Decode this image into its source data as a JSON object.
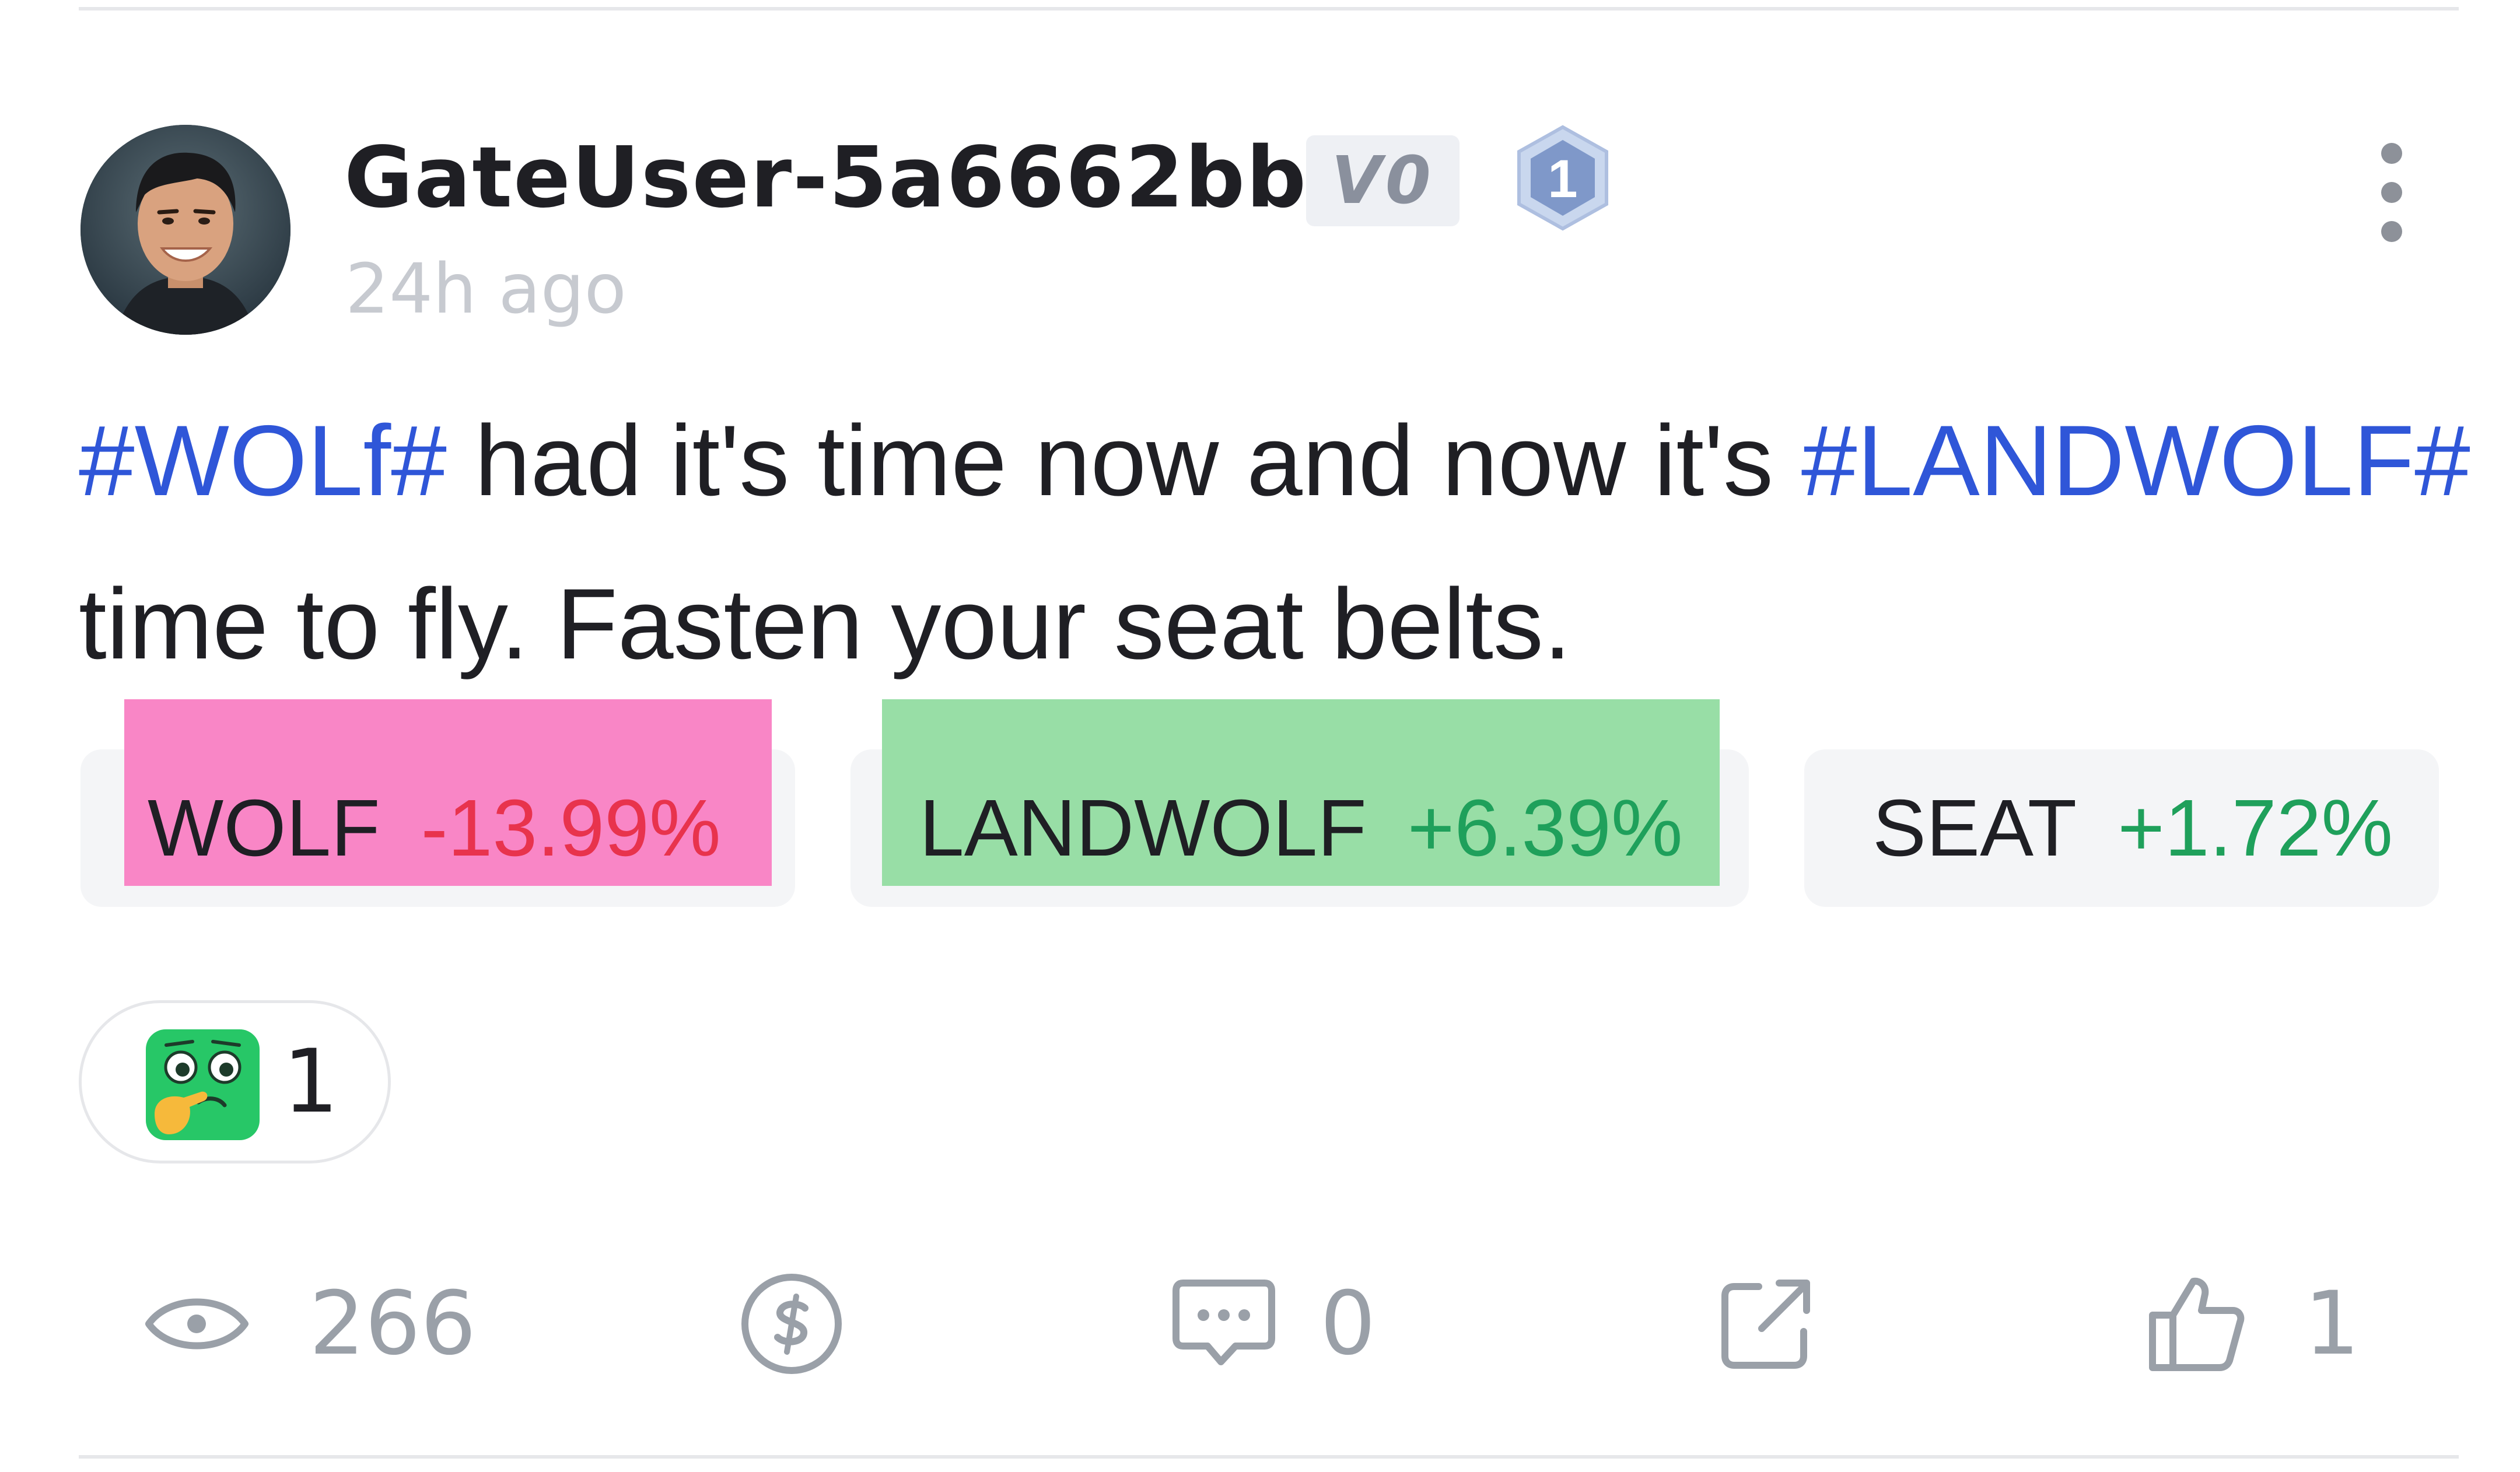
{
  "post": {
    "username": "GateUser-5a6662bb",
    "vip_badge": "V0",
    "level_badge": "1",
    "time_ago": "24h ago",
    "content": {
      "tag1": "#WOLf#",
      "text1": " had it's time now and now it's ",
      "tag2": "#LANDWOLF#",
      "text2": " time to fly. Fasten your seat belts."
    }
  },
  "coins": [
    {
      "symbol": "WOLF",
      "change": "-13.99%",
      "direction": "down",
      "highlight": "#f986c6"
    },
    {
      "symbol": "LANDWOLF",
      "change": "+6.39%",
      "direction": "up",
      "highlight": "#98dea6"
    },
    {
      "symbol": "SEAT",
      "change": "+1.72%",
      "direction": "up"
    }
  ],
  "reaction": {
    "icon": "thinking-emoji-icon",
    "count": "1"
  },
  "actions": {
    "views": "266",
    "comments": "0",
    "likes": "1"
  },
  "colors": {
    "hashtag": "#2f56d8",
    "negative": "#e8334d",
    "positive": "#1fa05b",
    "muted": "#9aa0a8"
  }
}
